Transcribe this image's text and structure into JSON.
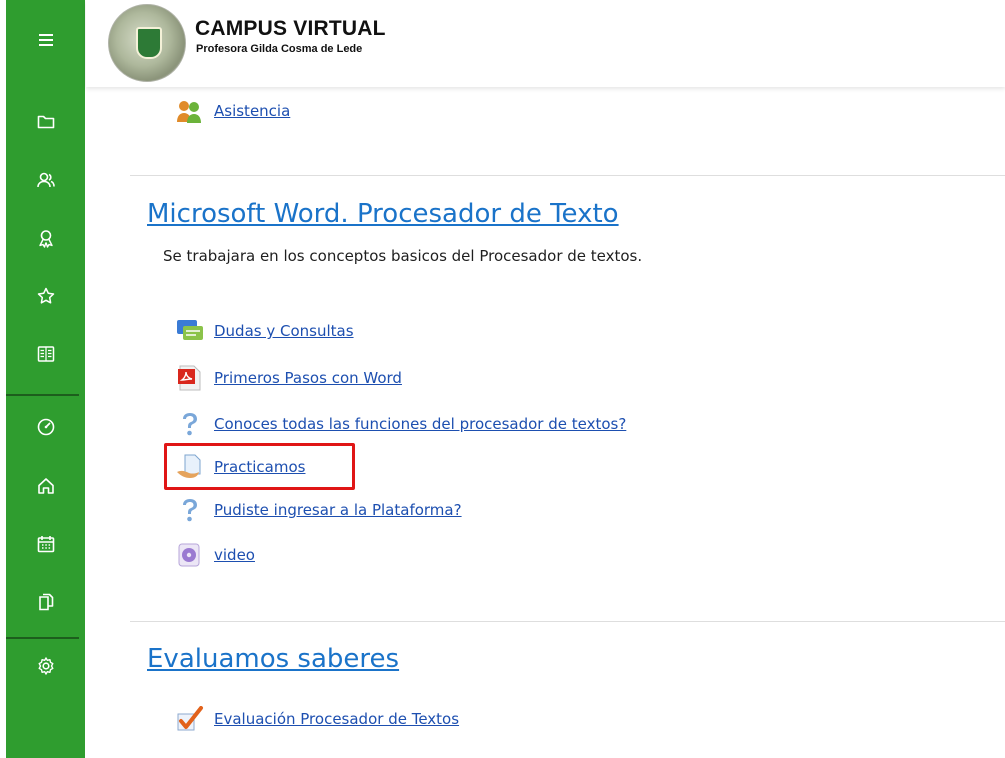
{
  "header": {
    "site_title": "CAMPUS VIRTUAL",
    "site_subtitle": "Profesora Gilda Cosma de Lede"
  },
  "rail": {
    "items": [
      {
        "icon": "hamburger-menu-icon"
      },
      {
        "icon": "folder-icon"
      },
      {
        "icon": "participants-icon"
      },
      {
        "icon": "badge-icon"
      },
      {
        "icon": "star-icon"
      },
      {
        "icon": "grades-book-icon"
      },
      {
        "icon": "dashboard-gauge-icon"
      },
      {
        "icon": "home-icon"
      },
      {
        "icon": "calendar-icon"
      },
      {
        "icon": "files-icon"
      },
      {
        "icon": "settings-gear-icon"
      }
    ],
    "color": "#2f9d2f"
  },
  "prev_section": {
    "activities": [
      {
        "label": "Asistencia",
        "icon": "attendance-icon"
      }
    ]
  },
  "section_word": {
    "title": "Microsoft Word. Procesador de Texto",
    "summary": "Se trabajara en los conceptos basicos del Procesador de textos.",
    "activities": [
      {
        "label": "Dudas y Consultas",
        "icon": "forum-icon"
      },
      {
        "label": "Primeros Pasos con Word",
        "icon": "pdf-icon"
      },
      {
        "label": "Conoces todas las funciones del procesador de textos?",
        "icon": "question-icon"
      },
      {
        "label": "Practicamos",
        "icon": "assignment-icon",
        "highlighted": true
      },
      {
        "label": "Pudiste ingresar a la Plataforma?",
        "icon": "question-icon"
      },
      {
        "label": "video",
        "icon": "video-icon"
      }
    ]
  },
  "section_eval": {
    "title": "Evaluamos saberes",
    "activities": [
      {
        "label": "Evaluación Procesador de Textos",
        "icon": "quiz-check-icon"
      }
    ]
  },
  "colors": {
    "link": "#1d4fb0",
    "section_title": "#1a73c9",
    "highlight": "#e01616"
  }
}
